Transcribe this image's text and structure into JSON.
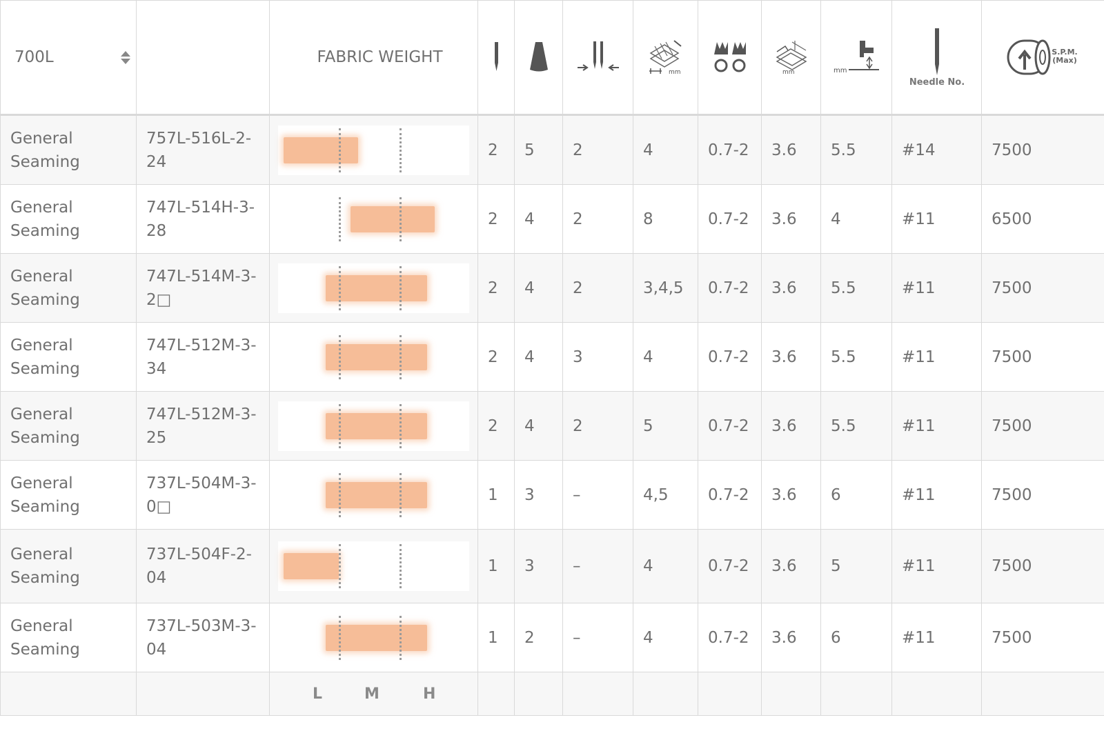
{
  "table": {
    "series_label": "700L",
    "fabric_weight_label": "FABRIC WEIGHT",
    "header_icons": [
      {
        "name": "needle-icon"
      },
      {
        "name": "thread-cone-icon"
      },
      {
        "name": "needle-gauge-icon"
      },
      {
        "name": "overedge-width-icon",
        "text": "mm"
      },
      {
        "name": "differential-feed-icon"
      },
      {
        "name": "stitch-length-icon",
        "text": "mm"
      },
      {
        "name": "presser-foot-lift-icon",
        "text": "mm"
      },
      {
        "name": "needle-number-icon",
        "text": "Needle No."
      },
      {
        "name": "spm-icon",
        "text": "S.P.M.",
        "text2": "(Max)"
      }
    ],
    "rows": [
      {
        "application": "General Seaming",
        "model": "757L-516L-2-24",
        "needles": "2",
        "threads": "5",
        "needle_gauge": "2",
        "overedge_width": "4",
        "diff_feed": "0.7-2",
        "stitch_length": "3.6",
        "foot_lift": "5.5",
        "needle_no": "#14",
        "spm": "7500",
        "fabric": {
          "from": 0.0,
          "to": 0.42
        }
      },
      {
        "application": "General Seaming",
        "model": "747L-514H-3-28",
        "needles": "2",
        "threads": "4",
        "needle_gauge": "2",
        "overedge_width": "8",
        "diff_feed": "0.7-2",
        "stitch_length": "3.6",
        "foot_lift": "4",
        "needle_no": "#11",
        "spm": "6500",
        "fabric": {
          "from": 0.35,
          "to": 0.82
        }
      },
      {
        "application": "General Seaming",
        "model": "747L-514M-3-2□",
        "needles": "2",
        "threads": "4",
        "needle_gauge": "2",
        "overedge_width": "3,4,5",
        "diff_feed": "0.7-2",
        "stitch_length": "3.6",
        "foot_lift": "5.5",
        "needle_no": "#11",
        "spm": "7500",
        "fabric": {
          "from": 0.22,
          "to": 0.78
        }
      },
      {
        "application": "General Seaming",
        "model": "747L-512M-3-34",
        "needles": "2",
        "threads": "4",
        "needle_gauge": "3",
        "overedge_width": "4",
        "diff_feed": "0.7-2",
        "stitch_length": "3.6",
        "foot_lift": "5.5",
        "needle_no": "#11",
        "spm": "7500",
        "fabric": {
          "from": 0.22,
          "to": 0.78
        }
      },
      {
        "application": "General Seaming",
        "model": "747L-512M-3-25",
        "needles": "2",
        "threads": "4",
        "needle_gauge": "2",
        "overedge_width": "5",
        "diff_feed": "0.7-2",
        "stitch_length": "3.6",
        "foot_lift": "5.5",
        "needle_no": "#11",
        "spm": "7500",
        "fabric": {
          "from": 0.22,
          "to": 0.78
        }
      },
      {
        "application": "General Seaming",
        "model": "737L-504M-3-0□",
        "needles": "1",
        "threads": "3",
        "needle_gauge": "–",
        "overedge_width": "4,5",
        "diff_feed": "0.7-2",
        "stitch_length": "3.6",
        "foot_lift": "6",
        "needle_no": "#11",
        "spm": "7500",
        "fabric": {
          "from": 0.22,
          "to": 0.78
        }
      },
      {
        "application": "General Seaming",
        "model": "737L-504F-2-04",
        "needles": "1",
        "threads": "3",
        "needle_gauge": "–",
        "overedge_width": "4",
        "diff_feed": "0.7-2",
        "stitch_length": "3.6",
        "foot_lift": "5",
        "needle_no": "#11",
        "spm": "7500",
        "fabric": {
          "from": 0.0,
          "to": 0.32
        }
      },
      {
        "application": "General Seaming",
        "model": "737L-503M-3-04",
        "needles": "1",
        "threads": "2",
        "needle_gauge": "–",
        "overedge_width": "4",
        "diff_feed": "0.7-2",
        "stitch_length": "3.6",
        "foot_lift": "6",
        "needle_no": "#11",
        "spm": "7500",
        "fabric": {
          "from": 0.22,
          "to": 0.78
        }
      }
    ],
    "footer_labels": {
      "light": "L",
      "medium": "M",
      "heavy": "H"
    },
    "colors": {
      "gauge_fill": "#f6bd98",
      "border": "#d9d9d9",
      "row_alt": "#f7f7f7",
      "text": "#707070"
    }
  }
}
